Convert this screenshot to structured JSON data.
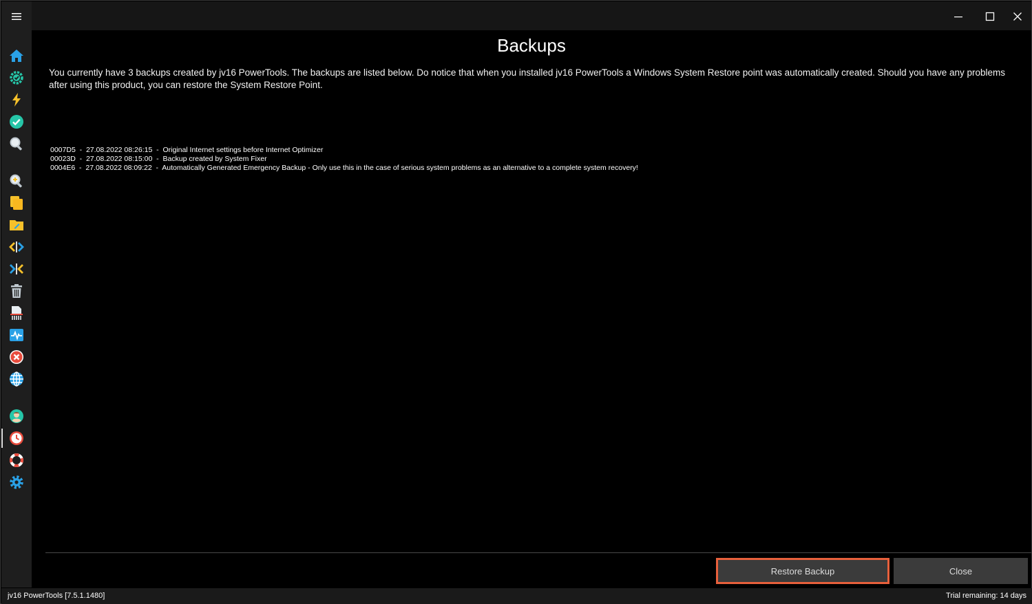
{
  "page": {
    "title": "Backups",
    "intro": "You currently have 3 backups created by jv16 PowerTools. The backups are listed below. Do notice that when you installed jv16 PowerTools a Windows System Restore point was automatically created. Should you have any problems after using this product, you can restore the System Restore Point."
  },
  "backups": [
    {
      "text": "0007D5  -  27.08.2022 08:26:15  -  Original Internet settings before Internet Optimizer"
    },
    {
      "text": "00023D  -  27.08.2022 08:15:00  -  Backup created by System Fixer"
    },
    {
      "text": "0004E6  -  27.08.2022 08:09:22  -  Automatically Generated Emergency Backup - Only use this in the case of serious system problems as an alternative to a complete system recovery!"
    }
  ],
  "buttons": {
    "restore_label": "Restore Backup",
    "close_label": "Close"
  },
  "status": {
    "left": "jv16 PowerTools [7.5.1.1480]",
    "right": "Trial remaining: 14 days"
  },
  "sidebar": {
    "icons": [
      "home-icon",
      "system-fixer-icon",
      "optimizer-bolt-icon",
      "checkmark-icon",
      "search-icon",
      "zoom-in-icon",
      "file-copy-icon",
      "folder-edit-icon",
      "code-icon",
      "merge-icon",
      "trash-icon",
      "file-shredder-icon",
      "activity-monitor-icon",
      "error-icon",
      "globe-icon",
      "user-avatar-icon",
      "backups-clock-icon",
      "help-lifebuoy-icon",
      "settings-gear-icon"
    ]
  },
  "colors": {
    "accent_orange": "#e8603c",
    "sidebar_bg": "#1e1e1e",
    "button_bg": "#3b3b3b"
  }
}
